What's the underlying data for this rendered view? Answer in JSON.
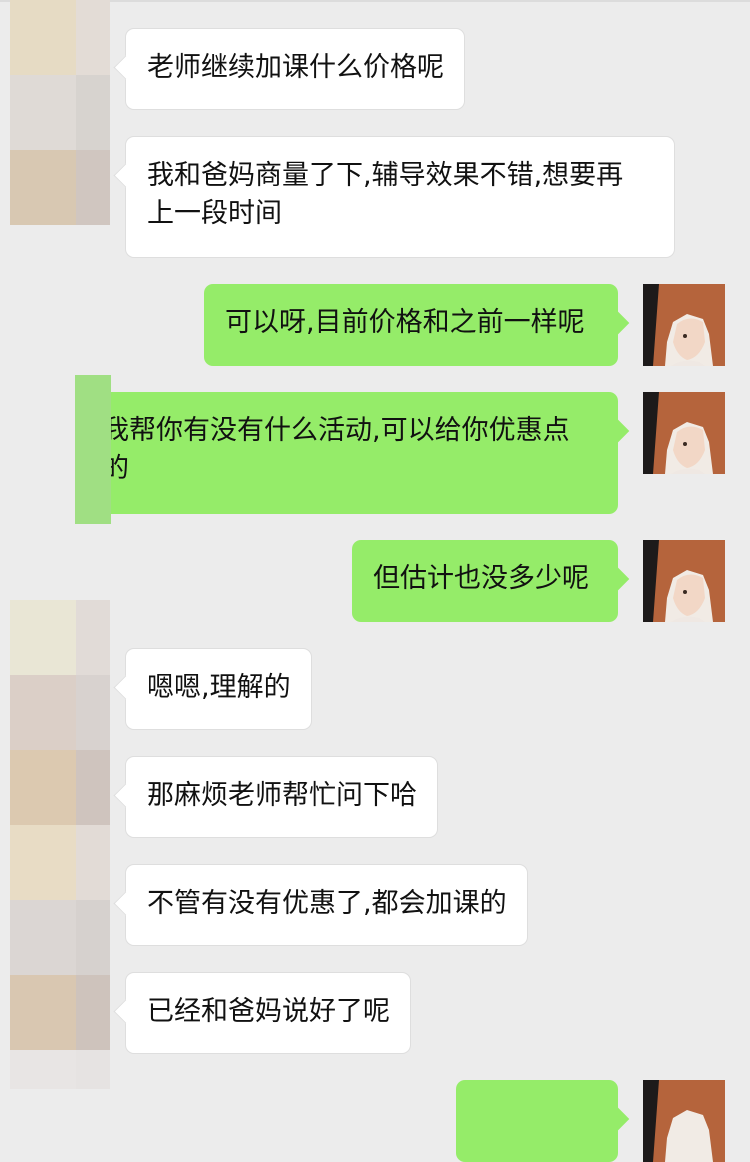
{
  "conversation": {
    "messages": [
      {
        "side": "in",
        "text": "老师继续加课什么价格呢"
      },
      {
        "side": "in",
        "text": "我和爸妈商量了下,辅导效果不错,想要再上一段时间",
        "lines": [
          "我和爸妈商量了下,辅导效果不错,想要再",
          "上一段时间"
        ]
      },
      {
        "side": "out",
        "text": "可以呀,目前价格和之前一样呢"
      },
      {
        "side": "out",
        "text": "我帮你有没有什么活动,可以给你优惠点的",
        "lines": [
          "我帮你有没有什么活动,可以给你优惠点",
          "的"
        ]
      },
      {
        "side": "out",
        "text": "但估计也没多少呢"
      },
      {
        "side": "in",
        "text": "嗯嗯,理解的"
      },
      {
        "side": "in",
        "text": "那麻烦老师帮忙问下哈"
      },
      {
        "side": "in",
        "text": "不管有没有优惠了,都会加课的"
      },
      {
        "side": "in",
        "text": "已经和爸妈说好了呢"
      },
      {
        "side": "out",
        "text": ""
      }
    ]
  },
  "colors": {
    "background": "#ececec",
    "incoming_bubble": "#ffffff",
    "outgoing_bubble": "#95ec69"
  },
  "icons": {
    "sender_avatar": "pixelated-avatar-icon",
    "self_avatar": "user-photo-avatar-icon"
  }
}
